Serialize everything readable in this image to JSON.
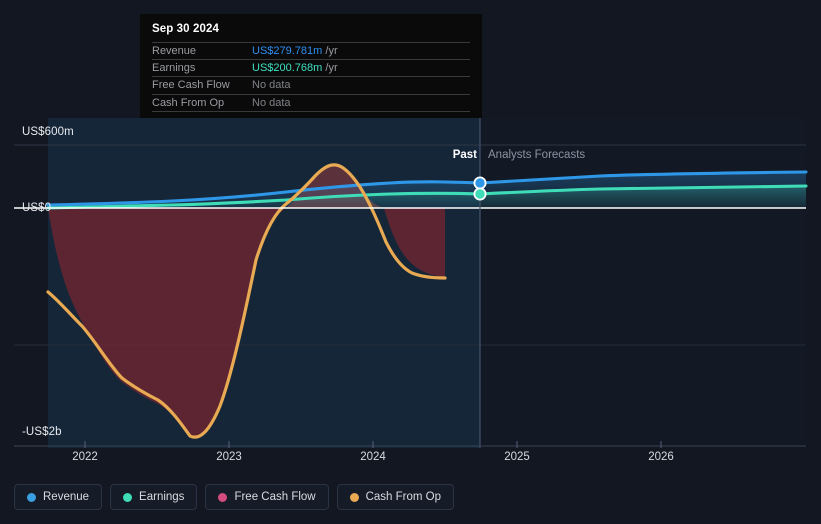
{
  "tooltip": {
    "date": "Sep 30 2024",
    "rows": [
      {
        "name": "Revenue",
        "value": "US$279.781m",
        "unit": "/yr",
        "kind": "revenue"
      },
      {
        "name": "Earnings",
        "value": "US$200.768m",
        "unit": "/yr",
        "kind": "earnings"
      },
      {
        "name": "Free Cash Flow",
        "value": "No data",
        "unit": "",
        "kind": "nodata"
      },
      {
        "name": "Cash From Op",
        "value": "No data",
        "unit": "",
        "kind": "nodata"
      }
    ]
  },
  "axis": {
    "y_labels": [
      {
        "text": "US$600m",
        "value": 600
      },
      {
        "text": "US$0",
        "value": 0
      },
      {
        "text": "-US$2b",
        "value": -2000
      }
    ],
    "x_labels": [
      "2022",
      "2023",
      "2024",
      "2025",
      "2026"
    ]
  },
  "regions": {
    "past_label": "Past",
    "forecast_label": "Analysts Forecasts"
  },
  "legend": [
    {
      "label": "Revenue",
      "color": "#3a9fe0"
    },
    {
      "label": "Earnings",
      "color": "#3fdcb8"
    },
    {
      "label": "Free Cash Flow",
      "color": "#d44b7d"
    },
    {
      "label": "Cash From Op",
      "color": "#e8aa52"
    }
  ],
  "colors": {
    "revenue": "#2f97e8",
    "earnings": "#3fdcb8",
    "free_cash_flow": "#d44b7d",
    "cash_from_op": "#e8aa52",
    "background": "#131722",
    "past_tint": "#16293c",
    "zero_line": "#ffffff",
    "grid": "#2c3545"
  },
  "chart_data": {
    "type": "line",
    "title": "",
    "xlabel": "",
    "ylabel": "",
    "ylim": [
      -2000,
      600
    ],
    "xlim": [
      2021.6,
      2026.5
    ],
    "grid": true,
    "legend_position": "bottom-left",
    "y_unit": "US$ millions",
    "gridlines": [
      600,
      0,
      -1000,
      -2000
    ],
    "forecast_start": "2024.75",
    "annotations": [
      {
        "text": "Past",
        "x": 2024.6,
        "y": 520
      },
      {
        "text": "Analysts Forecasts",
        "x": 2024.85,
        "y": 520
      }
    ],
    "series": [
      {
        "name": "Revenue",
        "color": "#2f97e8",
        "x": [
          2021.75,
          2022.0,
          2022.25,
          2022.5,
          2022.75,
          2023.0,
          2023.25,
          2023.5,
          2023.75,
          2024.0,
          2024.25,
          2024.5,
          2024.75,
          2025.0,
          2025.25,
          2025.5,
          2025.75,
          2026.0,
          2026.25,
          2026.5
        ],
        "values": [
          40,
          48,
          55,
          64,
          72,
          85,
          100,
          120,
          150,
          185,
          225,
          258,
          280,
          300,
          312,
          320,
          326,
          332,
          338,
          344
        ],
        "marker_at_x": 2024.75,
        "marker_value": 279.781
      },
      {
        "name": "Earnings",
        "color": "#3fdcb8",
        "x": [
          2021.75,
          2022.0,
          2022.25,
          2022.5,
          2022.75,
          2023.0,
          2023.25,
          2023.5,
          2023.75,
          2024.0,
          2024.25,
          2024.5,
          2024.75,
          2025.0,
          2025.25,
          2025.5,
          2025.75,
          2026.0,
          2026.25,
          2026.5
        ],
        "values": [
          5,
          10,
          16,
          24,
          32,
          44,
          58,
          76,
          102,
          132,
          165,
          188,
          201,
          212,
          220,
          226,
          231,
          235,
          239,
          243
        ],
        "marker_at_x": 2024.75,
        "marker_value": 200.768
      },
      {
        "name": "Free Cash Flow",
        "color": "#d44b7d",
        "x": [],
        "values": [],
        "note": "No data"
      },
      {
        "name": "Cash From Op",
        "color": "#e8aa52",
        "x": [
          2021.75,
          2021.9,
          2022.05,
          2022.2,
          2022.35,
          2022.5,
          2022.62,
          2022.75,
          2022.9,
          2023.0,
          2023.12,
          2023.25,
          2023.4,
          2023.55,
          2023.7,
          2023.85,
          2024.0,
          2024.15,
          2024.3,
          2024.45,
          2024.55
        ],
        "values": [
          -1120,
          -1210,
          -1420,
          -1620,
          -1680,
          -1760,
          -1960,
          -1990,
          -1700,
          -1080,
          -350,
          -60,
          120,
          330,
          420,
          380,
          120,
          -400,
          -640,
          -700,
          -700
        ]
      }
    ]
  }
}
